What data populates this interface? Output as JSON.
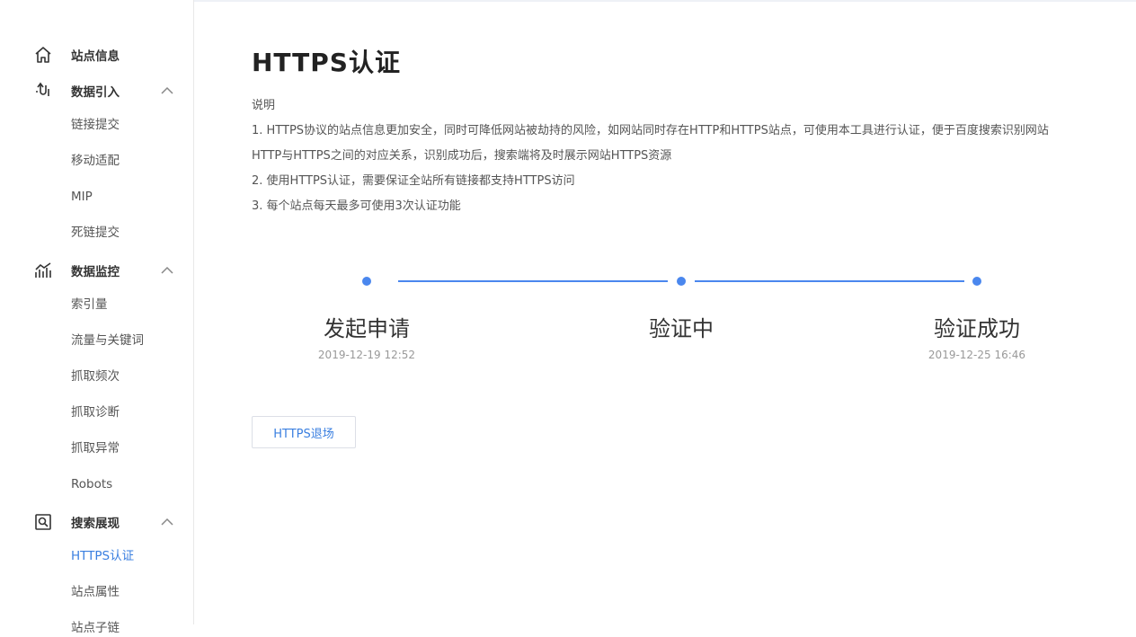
{
  "sidebar": {
    "sections": [
      {
        "label": "站点信息",
        "icon": "home-icon"
      },
      {
        "label": "数据引入",
        "icon": "data-import-icon",
        "items": [
          "链接提交",
          "移动适配",
          "MIP",
          "死链提交"
        ]
      },
      {
        "label": "数据监控",
        "icon": "chart-icon",
        "items": [
          "索引量",
          "流量与关键词",
          "抓取频次",
          "抓取诊断",
          "抓取异常",
          "Robots"
        ]
      },
      {
        "label": "搜索展现",
        "icon": "search-display-icon",
        "items": [
          "HTTPS认证",
          "站点属性",
          "站点子链"
        ]
      }
    ],
    "active_item": "HTTPS认证"
  },
  "main": {
    "title": "HTTPS认证",
    "desc_heading": "说明",
    "desc_lines": [
      "1. HTTPS协议的站点信息更加安全，同时可降低网站被劫持的风险，如网站同时存在HTTP和HTTPS站点，可使用本工具进行认证，便于百度搜索识别网站",
      "HTTP与HTTPS之间的对应关系，识别成功后，搜索端将及时展示网站HTTPS资源",
      "2. 使用HTTPS认证，需要保证全站所有链接都支持HTTPS访问",
      "3. 每个站点每天最多可使用3次认证功能"
    ],
    "steps": [
      {
        "name": "发起申请",
        "time": "2019-12-19 12:52"
      },
      {
        "name": "验证中",
        "time": ""
      },
      {
        "name": "验证成功",
        "time": "2019-12-25 16:46"
      }
    ],
    "exit_button": "HTTPS退场"
  },
  "colors": {
    "accent": "#4a87ee",
    "active_link": "#3a7fe0"
  }
}
